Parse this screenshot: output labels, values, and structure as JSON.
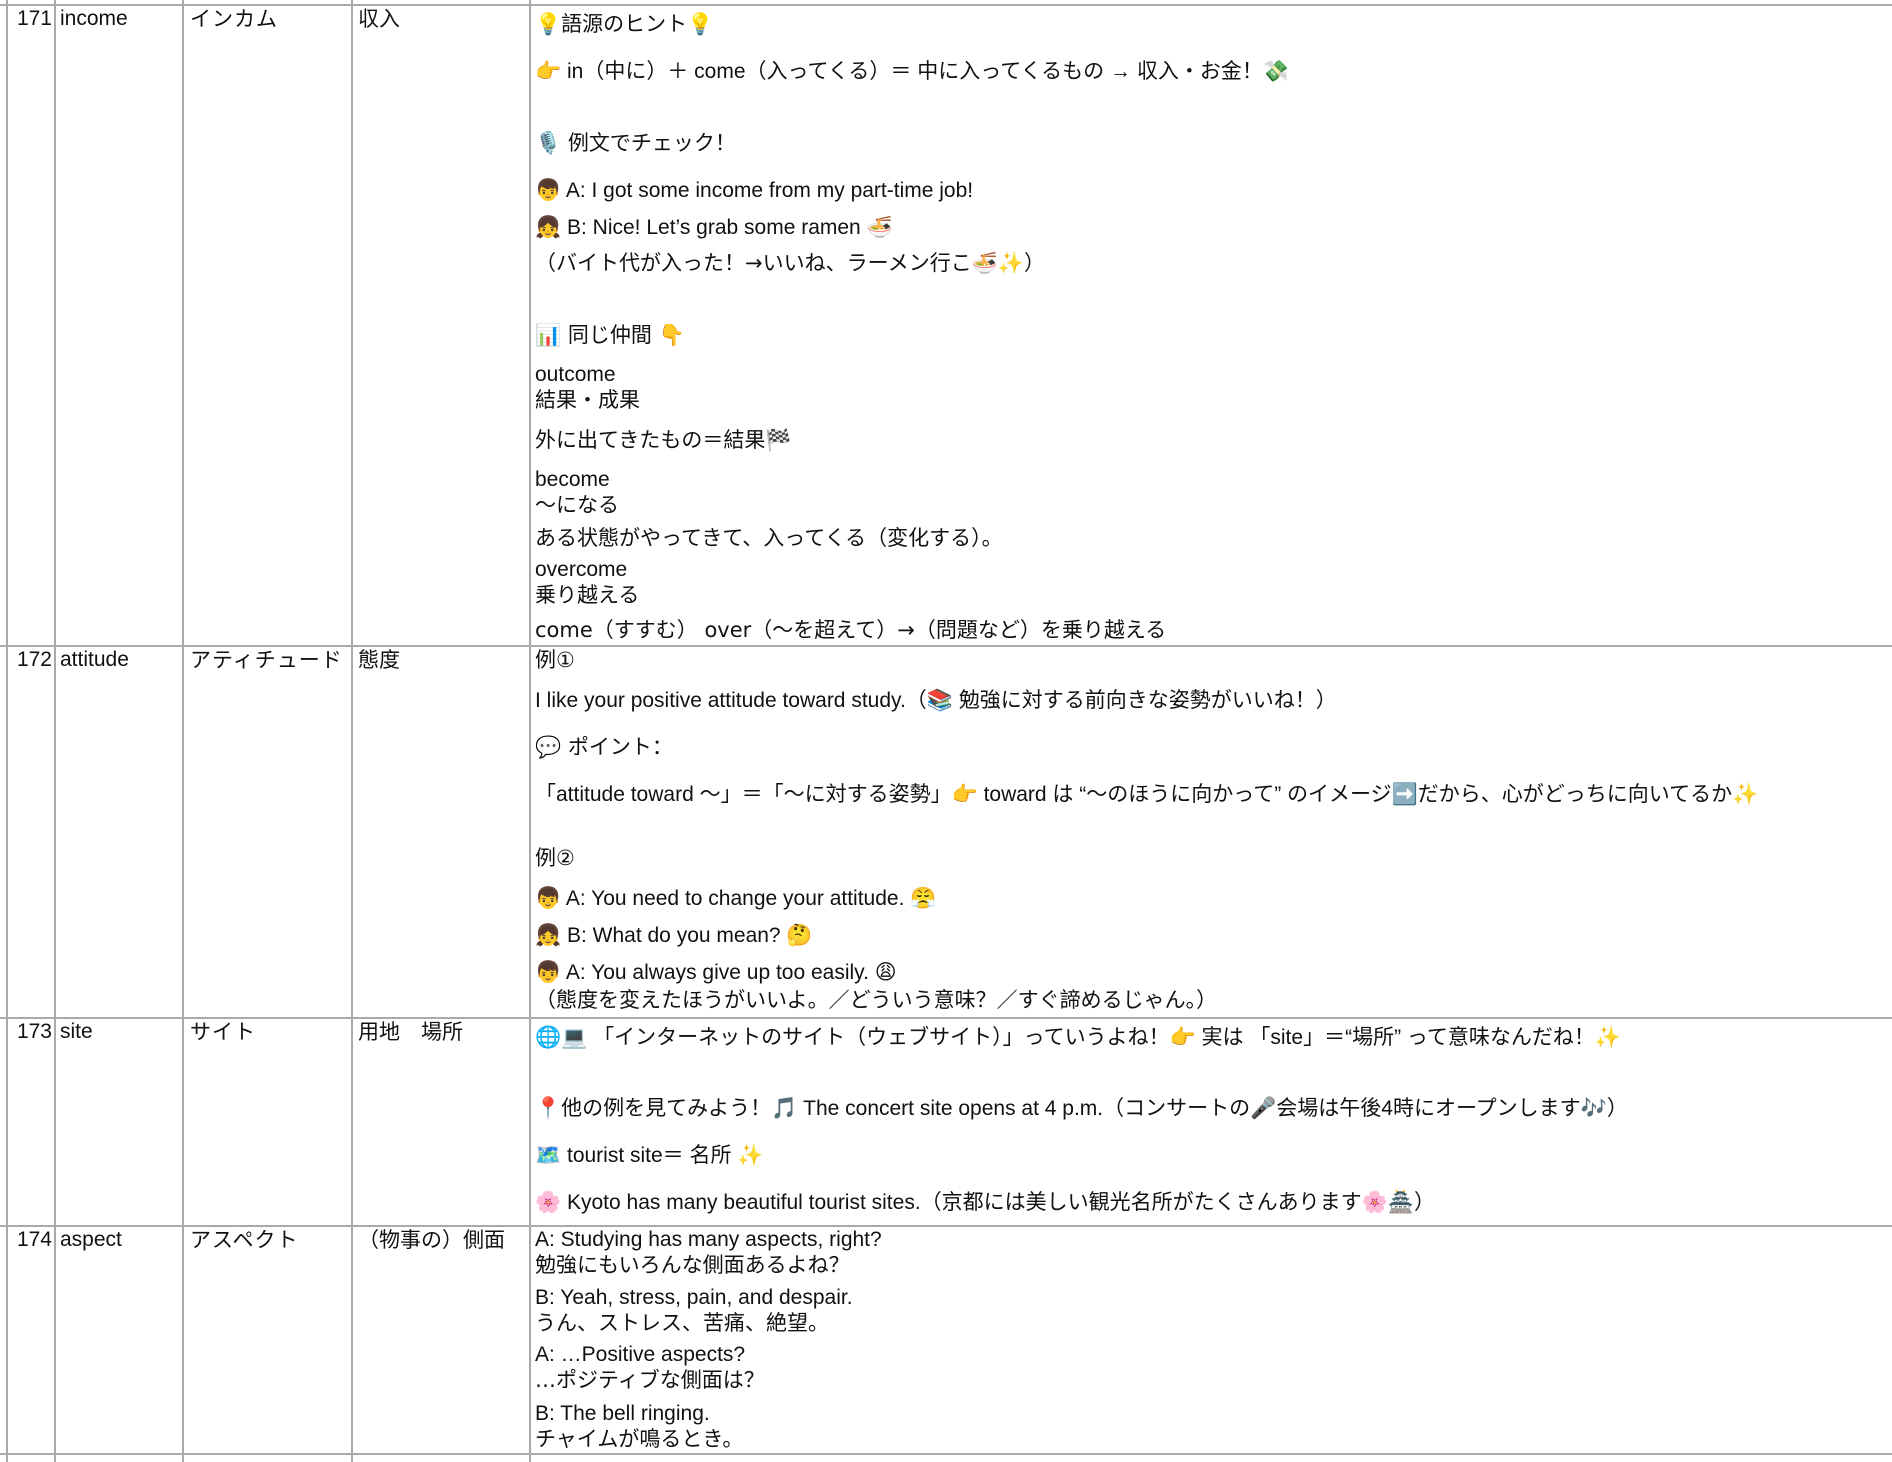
{
  "rows": [
    {
      "num": "171",
      "word": "income",
      "kata": "インカム",
      "meaning": "収入",
      "lines": [
        "💡語源のヒント💡",
        "👉 in（中に）＋ come（入ってくる）＝ 中に入ってくるもの → 収入・お金！💸",
        "🎙️ 例文でチェック！",
        "👦 A: I got some income from my part-time job!",
        "👧 B: Nice! Let’s grab some ramen 🍜",
        "（バイト代が入った！→いいね、ラーメン行こ🍜✨）",
        "📊 同じ仲間 👇",
        "outcome",
        "結果・成果",
        "外に出てきたもの＝結果🏁",
        "become",
        "〜になる",
        "ある状態がやってきて、入ってくる（変化する）。",
        "overcome",
        "乗り越える",
        "come（すすむ） over（〜を超えて）→（問題など）を乗り越える"
      ]
    },
    {
      "num": "172",
      "word": "attitude",
      "kata": "アティチュード",
      "meaning": "態度",
      "lines": [
        "例①",
        "I like your positive attitude toward study.（📚 勉強に対する前向きな姿勢がいいね！）",
        "💬 ポイント：",
        "「attitude toward 〜」＝「〜に対する姿勢」👉 toward は “〜のほうに向かって” のイメージ➡️だから、心がどっちに向いてるか✨",
        "例②",
        "👦 A: You need to change your attitude. 😤",
        "👧 B: What do you mean? 🤔",
        "👦 A: You always give up too easily. 😩",
        "（態度を変えたほうがいいよ。／どういう意味？／すぐ諦めるじゃん。）"
      ]
    },
    {
      "num": "173",
      "word": "site",
      "kata": "サイト",
      "meaning": "用地　場所",
      "lines": [
        "🌐💻 「インターネットのサイト（ウェブサイト）」っていうよね！👉 実は 「site」＝“場所” って意味なんだね！✨",
        "📍他の例を見てみよう！🎵 The concert site opens at 4 p.m.（コンサートの🎤会場は午後4時にオープンします🎶）",
        "🗺️ tourist site＝ 名所 ✨",
        "🌸 Kyoto has many beautiful tourist sites.（京都には美しい観光名所がたくさんあります🌸🏯）"
      ]
    },
    {
      "num": "174",
      "word": "aspect",
      "kata": "アスペクト",
      "meaning": "（物事の）側面",
      "lines": [
        "A: Studying has many aspects, right?",
        "勉強にもいろんな側面あるよね？",
        "B: Yeah, stress, pain, and despair.",
        "うん、ストレス、苦痛、絶望。",
        "A: …Positive aspects?",
        "…ポジティブな側面は？",
        "B: The bell ringing.",
        "チャイムが鳴るとき。"
      ]
    }
  ]
}
